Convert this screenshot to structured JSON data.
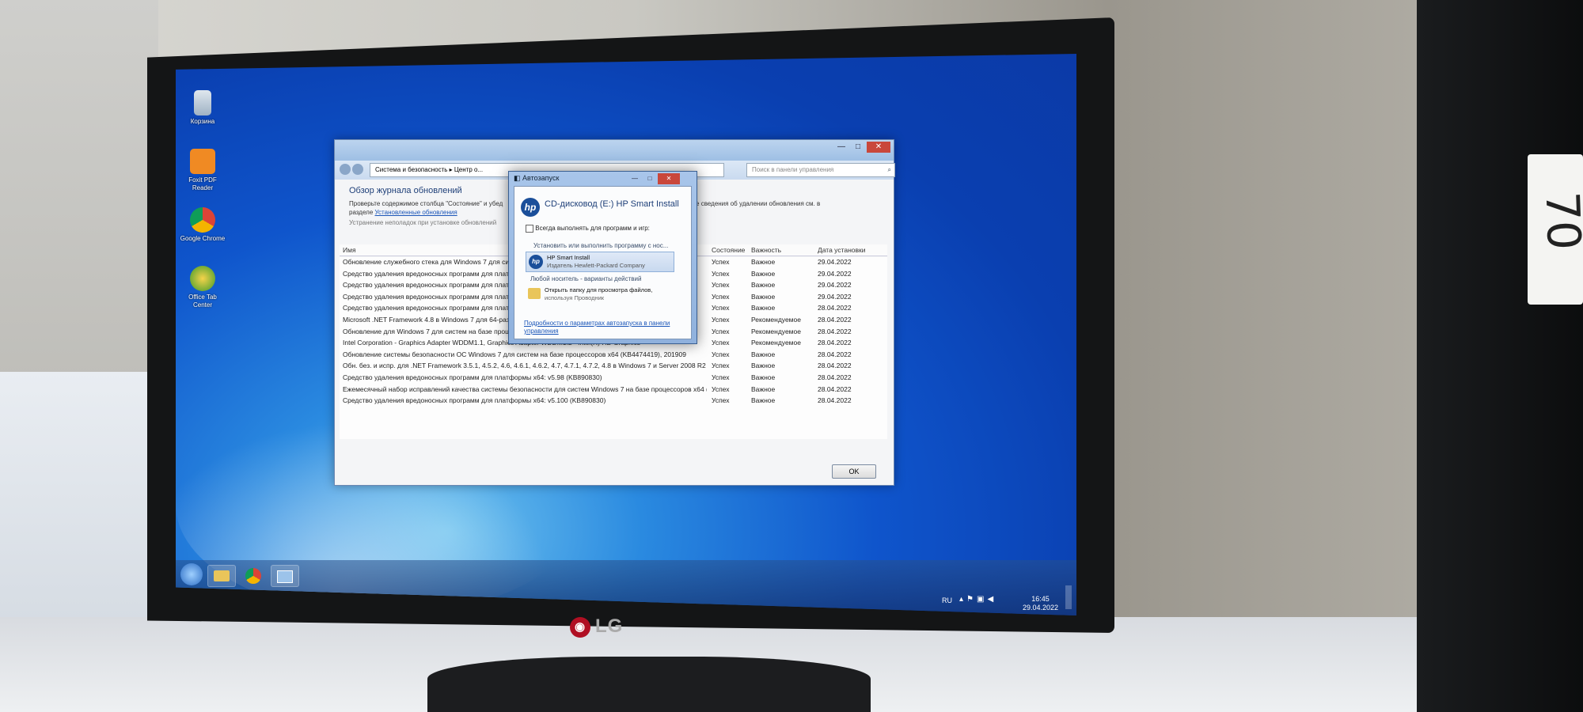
{
  "desktop": {
    "icons": [
      {
        "label": "Корзина",
        "icon": "recycle-bin-icon"
      },
      {
        "label": "Foxit PDF Reader",
        "icon": "foxit-pdf-icon"
      },
      {
        "label": "Google Chrome",
        "icon": "chrome-icon"
      },
      {
        "label": "Office Tab Center",
        "icon": "office-tab-icon"
      }
    ]
  },
  "update_window": {
    "breadcrumb": [
      "Система и безопасность",
      "Центр о..."
    ],
    "search_placeholder": "Поиск в панели управления",
    "heading": "Обзор журнала обновлений",
    "description_left": "Проверьте содержимое столбца \"Состояние\" и убед",
    "description_link_prefix": "разделе ",
    "description_link": "Установленные обновления",
    "description_right": "дополнительные сведения об удалении обновления см. в",
    "troubleshoot_link": "Устранение неполадок при установке обновлений",
    "columns": [
      "Имя",
      "Состояние",
      "Важность",
      "Дата установки"
    ],
    "rows": [
      {
        "name": "Обновление служебного стека для Windows 7 для систем",
        "status": "Успех",
        "importance": "Важное",
        "date": "29.04.2022"
      },
      {
        "name": "Средство удаления вредоносных программ для платформ",
        "status": "Успех",
        "importance": "Важное",
        "date": "29.04.2022"
      },
      {
        "name": "Средство удаления вредоносных программ для платформ",
        "status": "Успех",
        "importance": "Важное",
        "date": "29.04.2022"
      },
      {
        "name": "Средство удаления вредоносных программ для платформ",
        "status": "Успех",
        "importance": "Важное",
        "date": "29.04.2022"
      },
      {
        "name": "Средство удаления вредоносных программ для платформ",
        "status": "Успех",
        "importance": "Важное",
        "date": "28.04.2022"
      },
      {
        "name": "Microsoft .NET Framework 4.8 в Windows 7 для 64-разряд",
        "status": "Успех",
        "importance": "Рекомендуемое",
        "date": "28.04.2022"
      },
      {
        "name": "Обновление для Windows 7 для систем на базе процессо",
        "status": "Успех",
        "importance": "Рекомендуемое",
        "date": "28.04.2022"
      },
      {
        "name": "Intel Corporation - Graphics Adapter WDDM1.1, Graphics Adapter WDDM1.2 - Intel(R) HD Graphics",
        "status": "Успех",
        "importance": "Рекомендуемое",
        "date": "28.04.2022"
      },
      {
        "name": "Обновление системы безопасности ОС Windows 7 для систем на базе процессоров x64 (KB4474419), 201909",
        "status": "Успех",
        "importance": "Важное",
        "date": "28.04.2022"
      },
      {
        "name": "Обн. без. и испр. для .NET Framework 3.5.1, 4.5.2, 4.6, 4.6.1, 4.6.2, 4.7, 4.7.1, 4.7.2, 4.8 в Windows 7 и Server 2008 R2 для x64 (KB...",
        "status": "Успех",
        "importance": "Важное",
        "date": "28.04.2022"
      },
      {
        "name": "Средство удаления вредоносных программ для платформы x64: v5.98 (KB890830)",
        "status": "Успех",
        "importance": "Важное",
        "date": "28.04.2022"
      },
      {
        "name": "Ежемесячный набор исправлений качества системы безопасности для систем Windows 7 на базе процессоров x64 (KB4...",
        "status": "Успех",
        "importance": "Важное",
        "date": "28.04.2022"
      },
      {
        "name": "Средство удаления вредоносных программ для платформы x64: v5.100 (KB890830)",
        "status": "Успех",
        "importance": "Важное",
        "date": "28.04.2022"
      }
    ],
    "ok_label": "OK"
  },
  "autorun": {
    "title": "Автозапуск",
    "drive": "CD-дисковод (E:) HP Smart Install",
    "always_label": "Всегда выполнять для программ и игр:",
    "install_section": "Установить или выполнить программу с нос...",
    "program_name": "HP Smart Install",
    "program_publisher": "Издатель Hewlett-Packard Company",
    "any_media_section": "Любой носитель - варианты действий",
    "open_folder_line1": "Открыть папку для просмотра файлов,",
    "open_folder_line2": "используя Проводник",
    "settings_link": "Подробности о параметрах автозапуска в панели управления"
  },
  "taskbar": {
    "language": "RU",
    "time": "16:45",
    "date": "29.04.2022"
  },
  "monitor": {
    "brand": "LG"
  },
  "sticker_text": "70"
}
